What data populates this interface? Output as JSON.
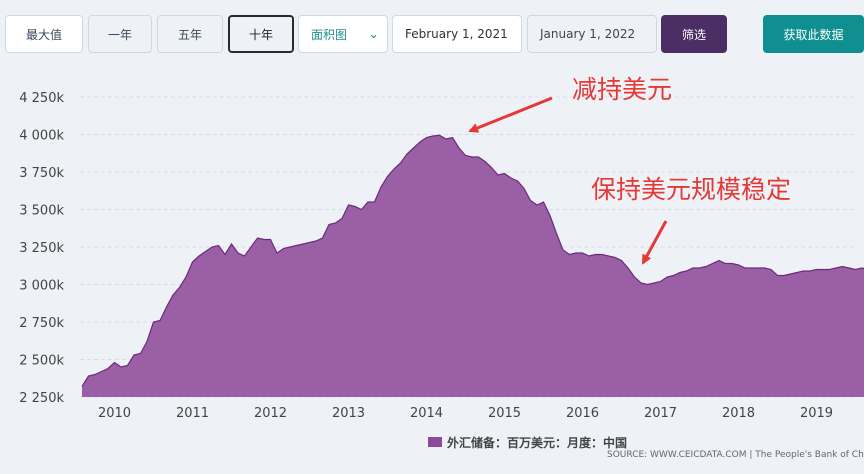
{
  "toolbar": {
    "range_max": "最大值",
    "range_1y": "一年",
    "range_5y": "五年",
    "range_10y": "十年",
    "chart_type": "面积图",
    "date_from": "February 1, 2021",
    "date_to": "January 1, 2022",
    "filter_label": "筛选",
    "fetch_label": "获取此数据"
  },
  "legend_label": "外汇储备：百万美元：月度：中国",
  "source_label": "SOURCE: WWW.CEICDATA.COM | The People's Bank of China",
  "annotations": {
    "top": "减持美元",
    "right": "保持美元规模稳定"
  },
  "colors": {
    "series_fill": "#8e4a9a",
    "series_stroke": "#6a2c7a",
    "arrow": "#e53935",
    "filter_button": "#4b2e63",
    "fetch_button": "#0f8f8f"
  },
  "chart_data": {
    "type": "area",
    "y_ticks": [
      "2 250k",
      "2 500k",
      "2 750k",
      "3 000k",
      "3 250k",
      "3 500k",
      "3 750k",
      "4 000k",
      "4 250k"
    ],
    "y_tick_values": [
      2250000,
      2500000,
      2750000,
      3000000,
      3250000,
      3500000,
      3750000,
      4000000,
      4250000
    ],
    "x_ticks": [
      "2010",
      "2011",
      "2012",
      "2013",
      "2014",
      "2015",
      "2016",
      "2017",
      "2018",
      "2019"
    ],
    "ylim": [
      2250000,
      4250000
    ],
    "grid": true,
    "legend": "bottom-center",
    "series": [
      {
        "name": "外汇储备：百万美元：月度：中国",
        "points": [
          [
            "2009-08",
            2320000
          ],
          [
            "2009-09",
            2390000
          ],
          [
            "2009-10",
            2400000
          ],
          [
            "2009-11",
            2420000
          ],
          [
            "2009-12",
            2440000
          ],
          [
            "2010-01",
            2480000
          ],
          [
            "2010-02",
            2450000
          ],
          [
            "2010-03",
            2460000
          ],
          [
            "2010-04",
            2530000
          ],
          [
            "2010-05",
            2540000
          ],
          [
            "2010-06",
            2620000
          ],
          [
            "2010-07",
            2750000
          ],
          [
            "2010-08",
            2760000
          ],
          [
            "2010-09",
            2850000
          ],
          [
            "2010-10",
            2930000
          ],
          [
            "2010-11",
            2980000
          ],
          [
            "2010-12",
            3050000
          ],
          [
            "2011-01",
            3150000
          ],
          [
            "2011-02",
            3190000
          ],
          [
            "2011-03",
            3220000
          ],
          [
            "2011-04",
            3250000
          ],
          [
            "2011-05",
            3260000
          ],
          [
            "2011-06",
            3200000
          ],
          [
            "2011-07",
            3270000
          ],
          [
            "2011-08",
            3210000
          ],
          [
            "2011-09",
            3190000
          ],
          [
            "2011-10",
            3250000
          ],
          [
            "2011-11",
            3310000
          ],
          [
            "2011-12",
            3300000
          ],
          [
            "2012-01",
            3300000
          ],
          [
            "2012-02",
            3210000
          ],
          [
            "2012-03",
            3240000
          ],
          [
            "2012-04",
            3250000
          ],
          [
            "2012-05",
            3260000
          ],
          [
            "2012-06",
            3270000
          ],
          [
            "2012-07",
            3280000
          ],
          [
            "2012-08",
            3290000
          ],
          [
            "2012-09",
            3310000
          ],
          [
            "2012-10",
            3400000
          ],
          [
            "2012-11",
            3410000
          ],
          [
            "2012-12",
            3440000
          ],
          [
            "2013-01",
            3530000
          ],
          [
            "2013-02",
            3520000
          ],
          [
            "2013-03",
            3500000
          ],
          [
            "2013-04",
            3550000
          ],
          [
            "2013-05",
            3550000
          ],
          [
            "2013-06",
            3650000
          ],
          [
            "2013-07",
            3720000
          ],
          [
            "2013-08",
            3770000
          ],
          [
            "2013-09",
            3810000
          ],
          [
            "2013-10",
            3870000
          ],
          [
            "2013-11",
            3910000
          ],
          [
            "2013-12",
            3950000
          ],
          [
            "2014-01",
            3980000
          ],
          [
            "2014-02",
            3990000
          ],
          [
            "2014-03",
            3995000
          ],
          [
            "2014-04",
            3970000
          ],
          [
            "2014-05",
            3980000
          ],
          [
            "2014-06",
            3910000
          ],
          [
            "2014-07",
            3860000
          ],
          [
            "2014-08",
            3850000
          ],
          [
            "2014-09",
            3850000
          ],
          [
            "2014-10",
            3820000
          ],
          [
            "2014-11",
            3780000
          ],
          [
            "2014-12",
            3730000
          ],
          [
            "2015-01",
            3740000
          ],
          [
            "2015-02",
            3710000
          ],
          [
            "2015-03",
            3690000
          ],
          [
            "2015-04",
            3640000
          ],
          [
            "2015-05",
            3560000
          ],
          [
            "2015-06",
            3530000
          ],
          [
            "2015-07",
            3550000
          ],
          [
            "2015-08",
            3460000
          ],
          [
            "2015-09",
            3340000
          ],
          [
            "2015-10",
            3230000
          ],
          [
            "2015-11",
            3200000
          ],
          [
            "2015-12",
            3210000
          ],
          [
            "2016-01",
            3210000
          ],
          [
            "2016-02",
            3190000
          ],
          [
            "2016-03",
            3200000
          ],
          [
            "2016-04",
            3200000
          ],
          [
            "2016-05",
            3190000
          ],
          [
            "2016-06",
            3180000
          ],
          [
            "2016-07",
            3160000
          ],
          [
            "2016-08",
            3110000
          ],
          [
            "2016-09",
            3050000
          ],
          [
            "2016-10",
            3010000
          ],
          [
            "2016-11",
            3000000
          ],
          [
            "2016-12",
            3010000
          ],
          [
            "2017-01",
            3020000
          ],
          [
            "2017-02",
            3050000
          ],
          [
            "2017-03",
            3060000
          ],
          [
            "2017-04",
            3080000
          ],
          [
            "2017-05",
            3090000
          ],
          [
            "2017-06",
            3110000
          ],
          [
            "2017-07",
            3110000
          ],
          [
            "2017-08",
            3120000
          ],
          [
            "2017-09",
            3140000
          ],
          [
            "2017-10",
            3160000
          ],
          [
            "2017-11",
            3140000
          ],
          [
            "2017-12",
            3140000
          ],
          [
            "2018-01",
            3130000
          ],
          [
            "2018-02",
            3110000
          ],
          [
            "2018-03",
            3110000
          ],
          [
            "2018-04",
            3110000
          ],
          [
            "2018-05",
            3110000
          ],
          [
            "2018-06",
            3100000
          ],
          [
            "2018-07",
            3060000
          ],
          [
            "2018-08",
            3060000
          ],
          [
            "2018-09",
            3070000
          ],
          [
            "2018-10",
            3080000
          ],
          [
            "2018-11",
            3090000
          ],
          [
            "2018-12",
            3090000
          ],
          [
            "2019-01",
            3100000
          ],
          [
            "2019-02",
            3100000
          ],
          [
            "2019-03",
            3100000
          ],
          [
            "2019-04",
            3110000
          ],
          [
            "2019-05",
            3120000
          ],
          [
            "2019-06",
            3110000
          ],
          [
            "2019-07",
            3100000
          ],
          [
            "2019-08",
            3110000
          ],
          [
            "2019-09",
            3100000
          ]
        ]
      }
    ]
  }
}
